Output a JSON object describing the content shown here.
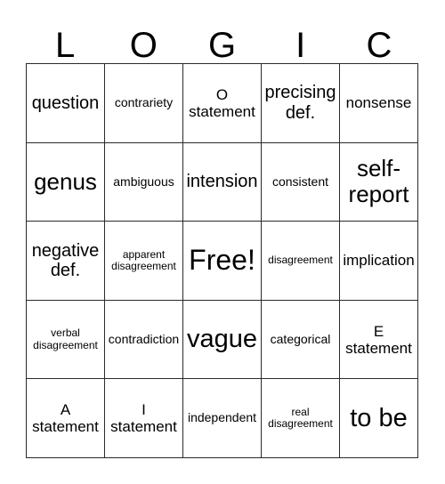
{
  "card": {
    "title_letters": [
      "L",
      "O",
      "G",
      "I",
      "C"
    ],
    "free_space": "Free!",
    "grid_rows": [
      [
        {
          "text": "question",
          "size": "sz-l"
        },
        {
          "text": "contrariety",
          "size": "sz-s"
        },
        {
          "text": "O\nstatement",
          "size": "sz-m"
        },
        {
          "text": "precising\ndef.",
          "size": "sz-l"
        },
        {
          "text": "nonsense",
          "size": "sz-m"
        }
      ],
      [
        {
          "text": "genus",
          "size": "sz-xl"
        },
        {
          "text": "ambiguous",
          "size": "sz-s"
        },
        {
          "text": "intension",
          "size": "sz-l"
        },
        {
          "text": "consistent",
          "size": "sz-s"
        },
        {
          "text": "self-\nreport",
          "size": "sz-xl"
        }
      ],
      [
        {
          "text": "negative\ndef.",
          "size": "sz-l"
        },
        {
          "text": "apparent\ndisagreement",
          "size": "sz-xs"
        },
        {
          "text": "Free!",
          "size": "sz-free"
        },
        {
          "text": "disagreement",
          "size": "sz-xs"
        },
        {
          "text": "implication",
          "size": "sz-m"
        }
      ],
      [
        {
          "text": "verbal\ndisagreement",
          "size": "sz-xs"
        },
        {
          "text": "contradiction",
          "size": "sz-s"
        },
        {
          "text": "vague",
          "size": "sz-xxl"
        },
        {
          "text": "categorical",
          "size": "sz-s"
        },
        {
          "text": "E\nstatement",
          "size": "sz-m"
        }
      ],
      [
        {
          "text": "A\nstatement",
          "size": "sz-m"
        },
        {
          "text": "I\nstatement",
          "size": "sz-m"
        },
        {
          "text": "independent",
          "size": "sz-s"
        },
        {
          "text": "real\ndisagreement",
          "size": "sz-xs"
        },
        {
          "text": "to be",
          "size": "sz-xxl"
        }
      ]
    ]
  },
  "colors": {
    "grid_line": "#2a2a2a",
    "text": "#000000",
    "background": "#ffffff"
  }
}
